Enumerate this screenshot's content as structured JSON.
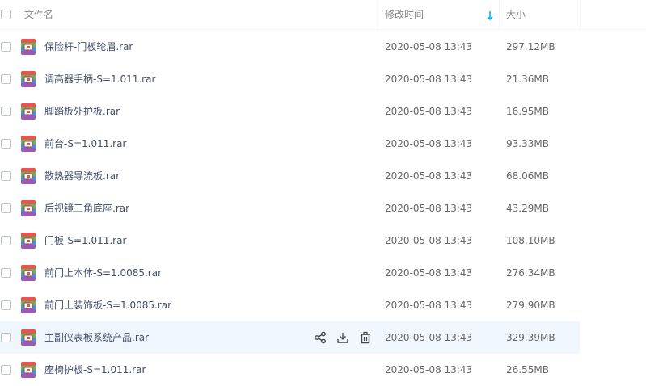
{
  "header": {
    "name": "文件名",
    "modified": "修改时间",
    "size": "大小"
  },
  "files": [
    {
      "name": "保险杆-门板轮眉.rar",
      "modified": "2020-05-08 13:43",
      "size": "297.12MB"
    },
    {
      "name": "调高器手柄-S=1.011.rar",
      "modified": "2020-05-08 13:43",
      "size": "21.36MB"
    },
    {
      "name": "脚踏板外护板.rar",
      "modified": "2020-05-08 13:43",
      "size": "16.95MB"
    },
    {
      "name": "前台-S=1.011.rar",
      "modified": "2020-05-08 13:43",
      "size": "93.33MB"
    },
    {
      "name": "散热器导流板.rar",
      "modified": "2020-05-08 13:43",
      "size": "68.06MB"
    },
    {
      "name": "后视镜三角底座.rar",
      "modified": "2020-05-08 13:43",
      "size": "43.29MB"
    },
    {
      "name": "门板-S=1.011.rar",
      "modified": "2020-05-08 13:43",
      "size": "108.10MB"
    },
    {
      "name": "前门上本体-S=1.0085.rar",
      "modified": "2020-05-08 13:43",
      "size": "276.34MB"
    },
    {
      "name": "前门上装饰板-S=1.0085.rar",
      "modified": "2020-05-08 13:43",
      "size": "279.90MB"
    },
    {
      "name": "主副仪表板系统产品.rar",
      "modified": "2020-05-08 13:43",
      "size": "329.39MB"
    },
    {
      "name": "座椅护板-S=1.011.rar",
      "modified": "2020-05-08 13:43",
      "size": "26.55MB"
    }
  ],
  "hovered_row_index": 9,
  "row_actions": [
    "share-icon",
    "download-icon",
    "delete-icon"
  ],
  "colors": {
    "hover_bg": "#f0f6fe",
    "accent": "#06a7ff",
    "text": "#424e67"
  }
}
